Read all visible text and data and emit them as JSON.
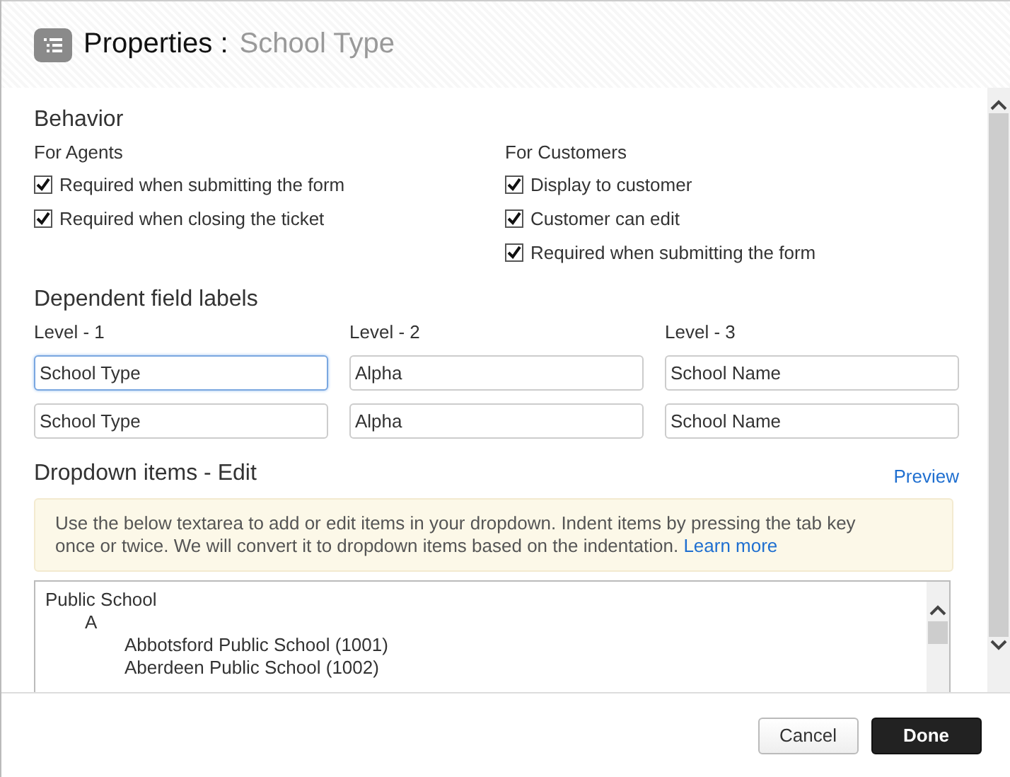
{
  "header": {
    "title": "Properties",
    "separator": ":",
    "subtitle": "School Type"
  },
  "behavior": {
    "heading": "Behavior",
    "groups": [
      {
        "label": "For Agents",
        "options": [
          {
            "label": "Required when submitting the form",
            "checked": true
          },
          {
            "label": "Required when closing the ticket",
            "checked": true
          }
        ]
      },
      {
        "label": "For Customers",
        "options": [
          {
            "label": "Display to customer",
            "checked": true
          },
          {
            "label": "Customer can edit",
            "checked": true
          },
          {
            "label": "Required when submitting the form",
            "checked": true
          }
        ]
      }
    ]
  },
  "dependent_labels": {
    "heading": "Dependent field labels",
    "columns": [
      {
        "label": "Level - 1",
        "fields": [
          {
            "value": "School Type",
            "focused": true
          },
          {
            "value": "School Type",
            "focused": false
          }
        ]
      },
      {
        "label": "Level - 2",
        "fields": [
          {
            "value": "Alpha",
            "focused": false
          },
          {
            "value": "Alpha",
            "focused": false
          }
        ]
      },
      {
        "label": "Level - 3",
        "fields": [
          {
            "value": "School Name",
            "focused": false
          },
          {
            "value": "School Name",
            "focused": false
          }
        ]
      }
    ]
  },
  "dropdown": {
    "heading": "Dropdown items - Edit",
    "preview_link": "Preview",
    "notice": "Use the below textarea to add or edit items in your dropdown. Indent items by pressing the tab key once or twice. We will convert it to dropdown items based on the indentation.",
    "notice_link": "Learn more",
    "items": [
      {
        "label": "Public School",
        "children": [
          {
            "label": "A",
            "children": [
              {
                "label": "Abbotsford Public School (1001)"
              },
              {
                "label": "Aberdeen Public School (1002)"
              }
            ]
          }
        ]
      }
    ]
  },
  "buttons": [
    {
      "label": "Cancel",
      "kind": "secondary"
    },
    {
      "label": "Done",
      "kind": "primary"
    }
  ]
}
